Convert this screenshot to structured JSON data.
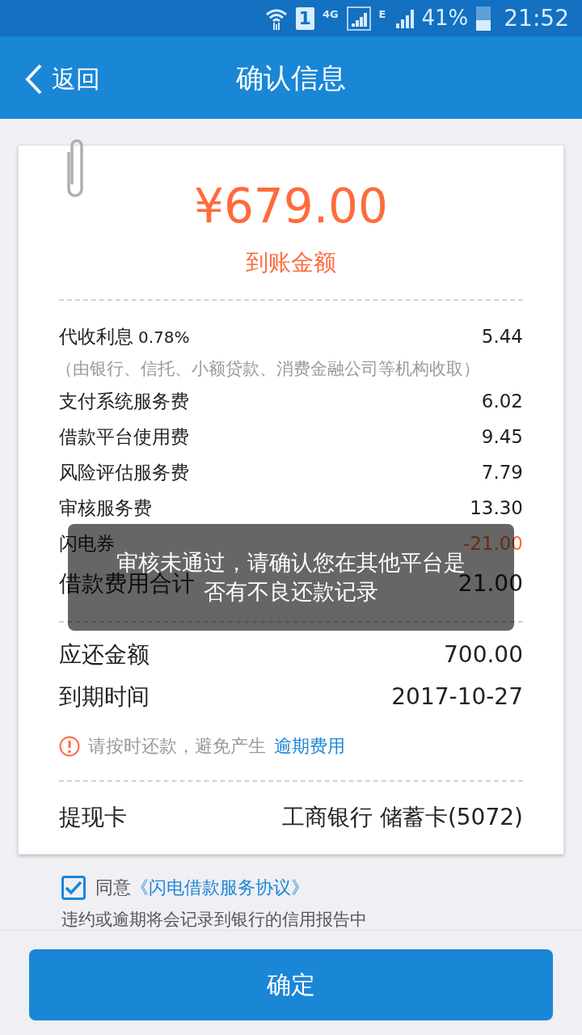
{
  "status_bar": {
    "sim": "1",
    "network": "4G",
    "network2": "E",
    "battery_text": "41%",
    "battery": {
      "level": 0.41
    },
    "time": "21:52"
  },
  "header": {
    "back": "返回",
    "title": "确认信息"
  },
  "amount": {
    "value": "¥679.00",
    "label": "到账金额"
  },
  "fees": [
    {
      "kind": "fee",
      "label": "代收利息",
      "extra": "0.78%",
      "value": "5.44"
    },
    {
      "kind": "note",
      "text": "（由银行、信托、小额贷款、消费金融公司等机构收取）"
    },
    {
      "kind": "fee",
      "label": "支付系统服务费",
      "value": "6.02"
    },
    {
      "kind": "fee",
      "label": "借款平台使用费",
      "value": "9.45"
    },
    {
      "kind": "fee",
      "label": "风险评估服务费",
      "value": "7.79"
    },
    {
      "kind": "fee",
      "label": "审核服务费",
      "value": "13.30"
    },
    {
      "kind": "discount",
      "label": "闪电券",
      "value": "-21.00"
    },
    {
      "kind": "total",
      "label": "借款费用合计",
      "value": "21.00"
    }
  ],
  "repay": [
    {
      "label": "应还金额",
      "value": "700.00"
    },
    {
      "label": "到期时间",
      "value": "2017-10-27"
    }
  ],
  "warning": {
    "text": "请按时还款，避免产生",
    "link": "逾期费用"
  },
  "card": {
    "label": "提现卡",
    "value": "工商银行 储蓄卡(5072)"
  },
  "agreement": {
    "checked": true,
    "prefix": "同意",
    "link": "《闪电借款服务协议》",
    "note": "违约或逾期将会记录到银行的信用报告中"
  },
  "confirm_button": "确定",
  "toast": "审核未通过，请确认您在其他平台是否有不良还款记录"
}
